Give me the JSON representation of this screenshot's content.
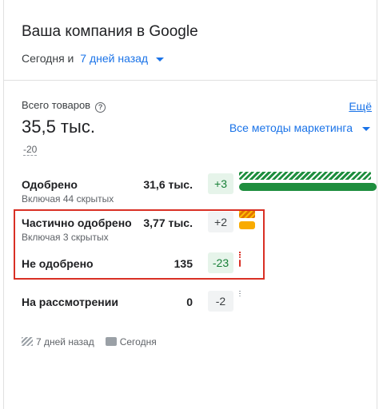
{
  "header": {
    "title": "Ваша компания в Google",
    "date_prefix": "Сегодня и",
    "date_range": "7 дней назад"
  },
  "summary": {
    "label": "Всего товаров",
    "help_icon": "help-circle-icon",
    "value": "35,5 тыс.",
    "delta": "-20",
    "more_link": "Ещё",
    "methods_dropdown": "Все методы маркетинга"
  },
  "rows": [
    {
      "name": "Одобрено",
      "sub": "Включая 44 скрытых",
      "value": "31,6 тыс.",
      "delta": "+3",
      "delta_style": "green",
      "bar_fraction": 0.89
    },
    {
      "name": "Частично одобрено",
      "sub": "Включая 3 скрытых",
      "value": "3,77 тыс.",
      "delta": "+2",
      "delta_style": "gray",
      "bar_fraction": 0.106
    },
    {
      "name": "Не одобрено",
      "sub": "",
      "value": "135",
      "delta": "-23",
      "delta_style": "green",
      "bar_fraction": 0.004
    },
    {
      "name": "На рассмотрении",
      "sub": "",
      "value": "0",
      "delta": "-2",
      "delta_style": "gray",
      "bar_fraction": 0.0
    }
  ],
  "legend": {
    "past_label": "7 дней назад",
    "today_label": "Сегодня"
  },
  "colors": {
    "accent": "#1a73e8",
    "approved": "#1e8e3e",
    "partial": "#f9ab00",
    "rejected": "#d93025",
    "highlight_box": "#d93025"
  }
}
